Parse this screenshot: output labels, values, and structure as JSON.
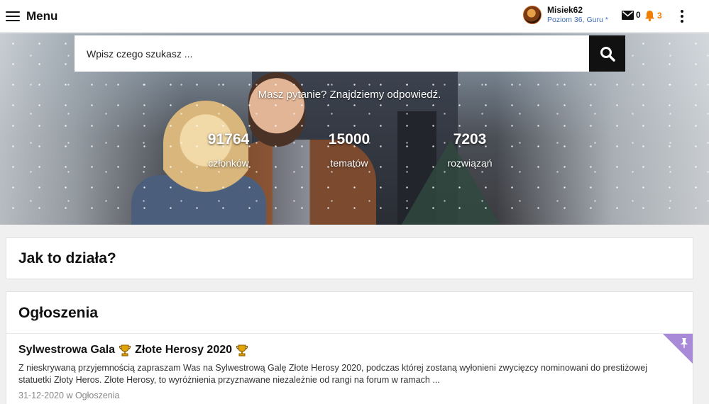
{
  "header": {
    "menu_label": "Menu",
    "user": {
      "name": "Misiek62",
      "rank": "Poziom 36, Guru *"
    },
    "mail_count": "0",
    "notif_count": "3"
  },
  "hero": {
    "search_placeholder": "Wpisz czego szukasz ...",
    "tagline": "Masz pytanie? Znajdziemy odpowiedź.",
    "stats": [
      {
        "value": "91764",
        "label": "członków"
      },
      {
        "value": "15000",
        "label": "tematów"
      },
      {
        "value": "7203",
        "label": "rozwiązań"
      }
    ]
  },
  "how_it_works": {
    "title": "Jak to działa?"
  },
  "announcements": {
    "title": "Ogłoszenia",
    "post": {
      "title_a": "Sylwestrowa Gala",
      "title_b": "Złote Herosy 2020",
      "excerpt": "Z nieskrywaną przyjemnością zapraszam Was na Sylwestrową Galę Złote Herosy 2020, podczas której zostaną wyłonieni zwycięzcy nominowani do prestiżowej statuetki Złoty Heros. Złote Herosy, to wyróżnienia przyznawane niezależnie od rangi na forum w ramach ...",
      "date": "31-12-2020",
      "location_prefix": "w",
      "location": "Ogłoszenia"
    }
  },
  "colors": {
    "accent": "#f07d00",
    "pin": "#a98ad8",
    "link": "#3f6fb5"
  }
}
